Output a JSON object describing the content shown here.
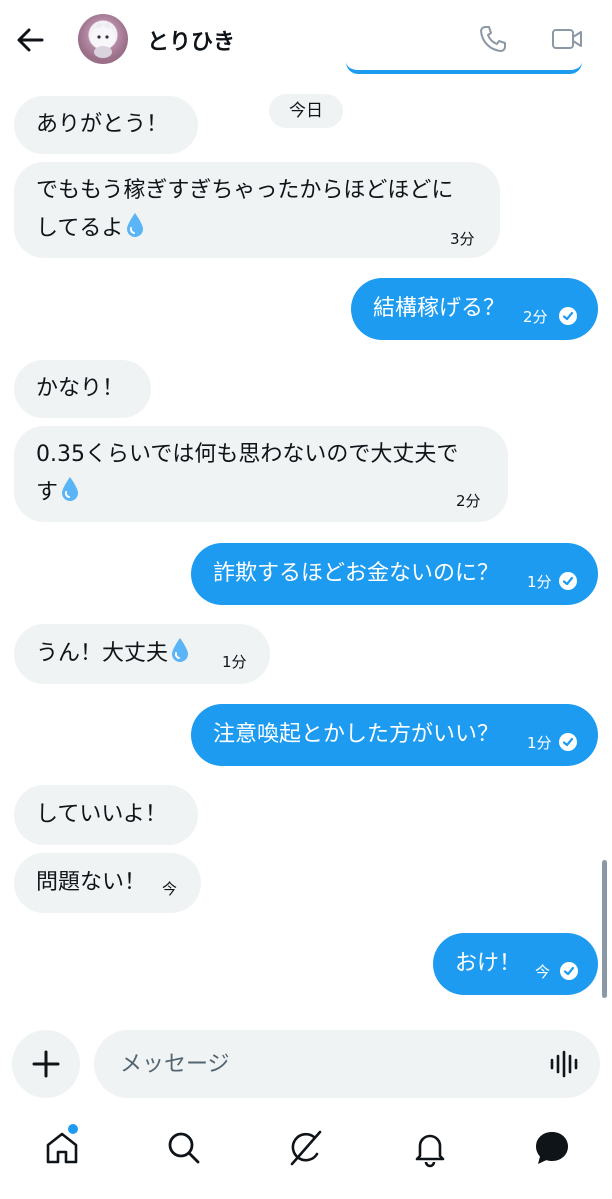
{
  "header": {
    "contact_name": "とりひき",
    "icons": [
      "back-arrow-icon",
      "phone-icon",
      "video-camera-icon"
    ]
  },
  "conversation": {
    "date_label": "今日",
    "messages": [
      {
        "direction": "in",
        "text": "ありがとう！",
        "time": ""
      },
      {
        "direction": "in",
        "line1": "でももう稼ぎすぎちゃったからほどほどに",
        "line2": "してるよ",
        "emoji": "droplet",
        "time": "3分"
      },
      {
        "direction": "out",
        "text": "結構稼げる？",
        "time": "2分",
        "status": "read"
      },
      {
        "direction": "in",
        "text": "かなり！",
        "time": ""
      },
      {
        "direction": "in",
        "line1": "0.35くらいでは何も思わないので大丈夫で",
        "line2": "す",
        "emoji": "droplet",
        "time": "2分"
      },
      {
        "direction": "out",
        "text": "詐欺するほどお金ないのに？",
        "time": "1分",
        "status": "read"
      },
      {
        "direction": "in",
        "text": "うん！大丈夫",
        "emoji": "droplet",
        "time": "1分"
      },
      {
        "direction": "out",
        "text": "注意喚起とかした方がいい？",
        "time": "1分",
        "status": "read"
      },
      {
        "direction": "in",
        "text": "していいよ！",
        "time": ""
      },
      {
        "direction": "in",
        "text": "問題ない！",
        "time": "今"
      },
      {
        "direction": "out",
        "text": "おけ！",
        "time": "今",
        "status": "read"
      }
    ]
  },
  "composer": {
    "placeholder": "メッセージ",
    "icons": [
      "plus-icon",
      "voice-waveform-icon"
    ]
  },
  "bottom_nav": {
    "items": [
      "home-icon",
      "search-icon",
      "grok-icon",
      "notifications-icon",
      "messages-icon"
    ],
    "home_has_badge": true
  },
  "colors": {
    "accent": "#1d9bf0",
    "incoming_bubble": "#eff3f4",
    "text": "#0f1419",
    "secondary_text": "#536471"
  }
}
